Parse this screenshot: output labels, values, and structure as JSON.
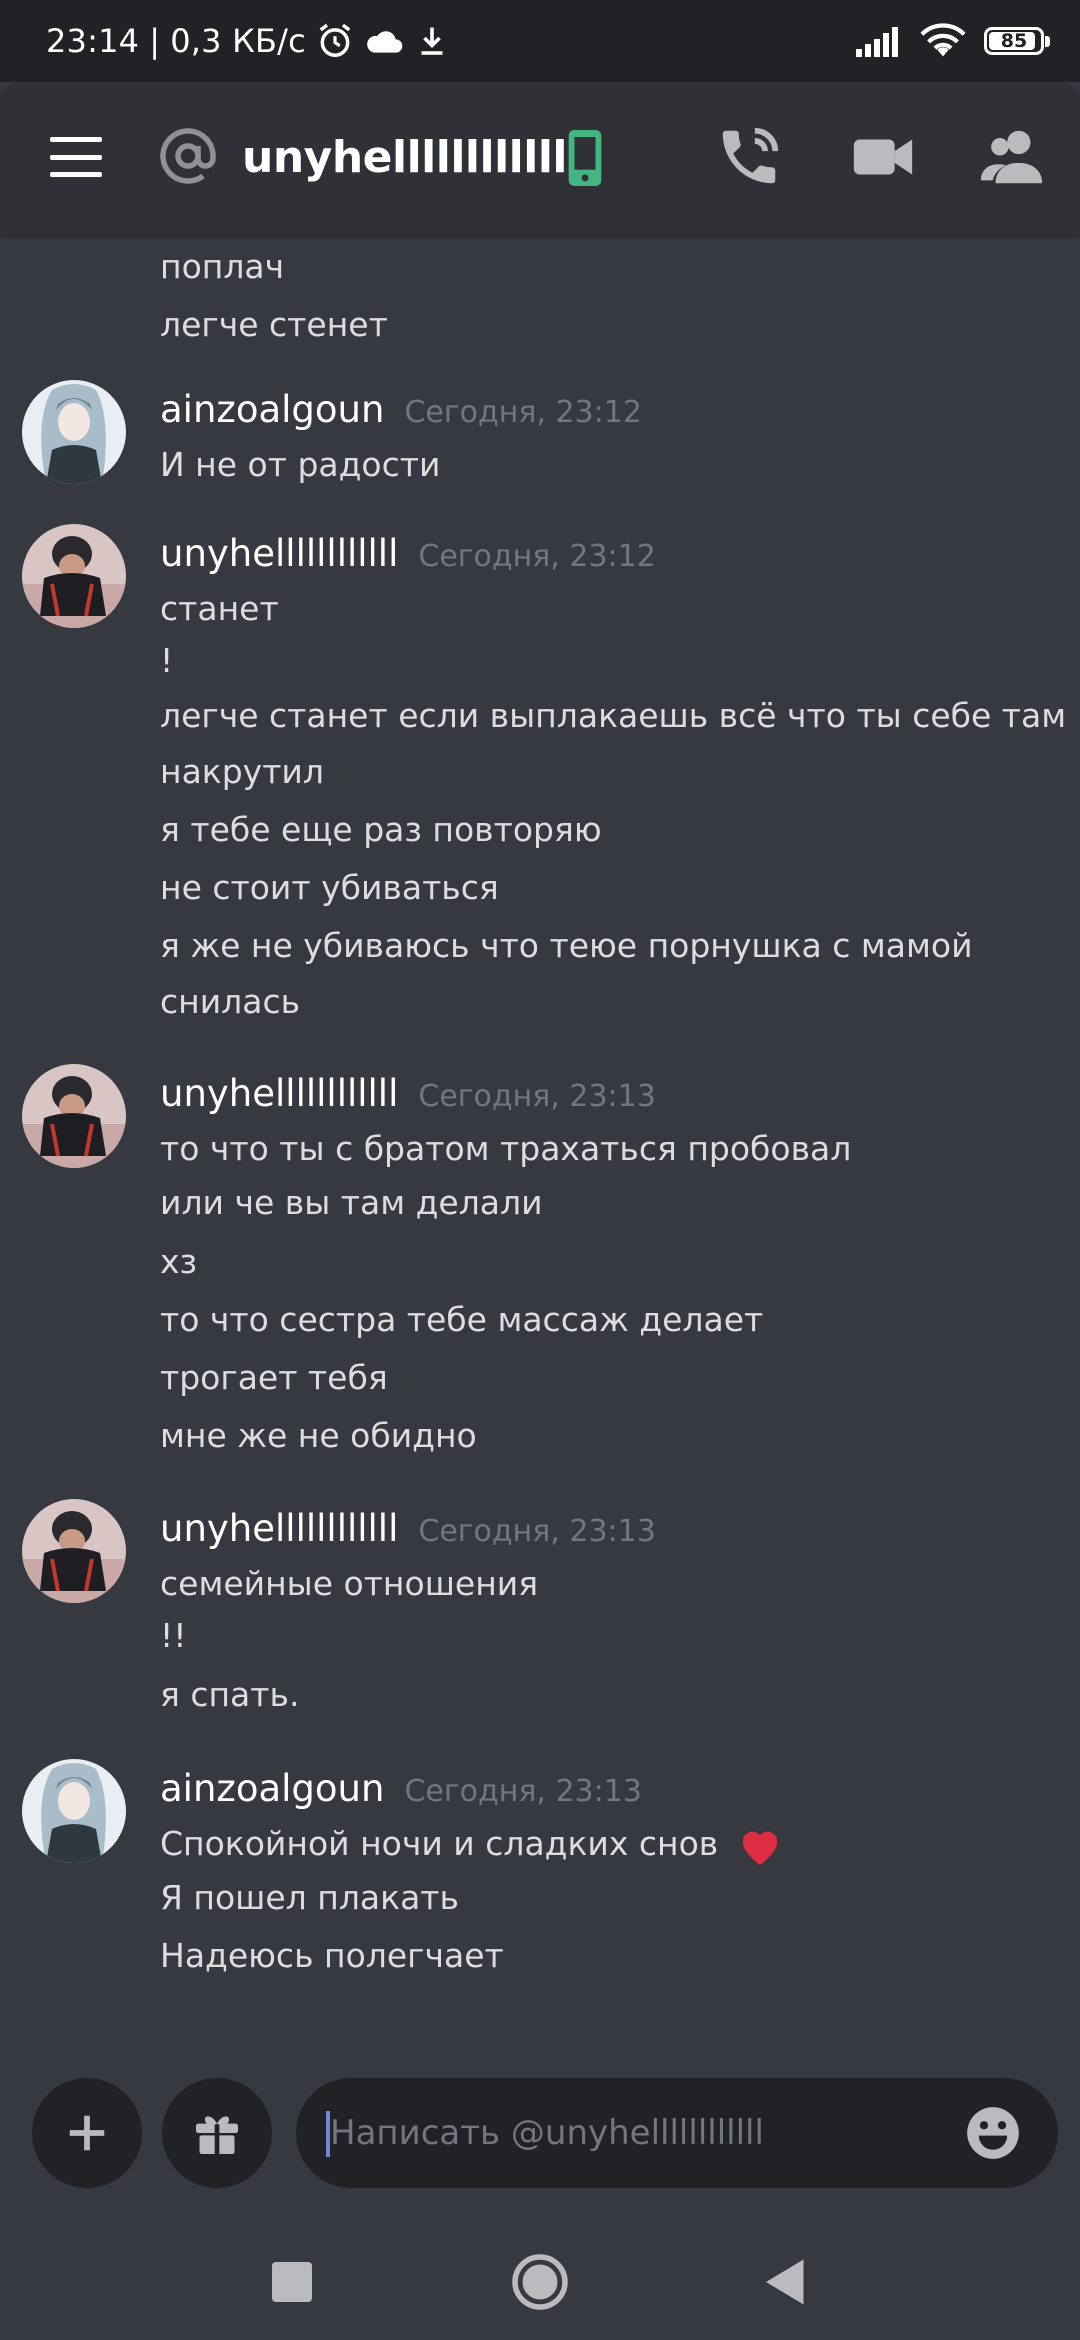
{
  "status_bar": {
    "time": "23:14",
    "separator": "|",
    "speed": "0,3 КБ/с",
    "battery": "85",
    "battery_level": 0.85
  },
  "header": {
    "channel_name": "unyhellllllllllll"
  },
  "messages": {
    "continued": [
      {
        "text": "поплач"
      },
      {
        "text": "легче стенет"
      }
    ],
    "g1": {
      "author": "ainzoalgoun",
      "time": "Сегодня, 23:12",
      "lines": [
        "И не от радости"
      ]
    },
    "g2": {
      "author": "unyhellllllllllll",
      "time": "Сегодня, 23:12",
      "lines": [
        "станет",
        "!",
        "легче станет если выплакаешь всё что ты себе там",
        "накрутил",
        "я тебе еще раз повторяю",
        "не стоит убиваться",
        "я же не убиваюсь что теюе порнушка с мамой",
        "снилась"
      ]
    },
    "g3": {
      "author": "unyhellllllllllll",
      "time": "Сегодня, 23:13",
      "lines": [
        "то что ты с братом трахаться пробовал",
        "или че вы там делали",
        "хз",
        "то что сестра тебе массаж делает",
        "трогает тебя",
        "мне же не обидно"
      ]
    },
    "g4": {
      "author": "unyhellllllllllll",
      "time": "Сегодня, 23:13",
      "lines": [
        "семейные отношения",
        "!!",
        "я спать."
      ]
    },
    "g5": {
      "author": "ainzoalgoun",
      "time": "Сегодня, 23:13",
      "lines": [
        "Спокойной ночи и сладких снов",
        "Я пошел плакать",
        "Надеюсь полегчает"
      ]
    }
  },
  "composer": {
    "placeholder": "Написать @unyhellllllllllll"
  },
  "colors": {
    "background": "#36393f",
    "header": "#2f3136",
    "input": "#202225",
    "online_green": "#43b581",
    "heart_red": "#dd2e44"
  },
  "icons": [
    "menu-icon",
    "at-icon",
    "mobile-icon",
    "voice-call-icon",
    "video-call-icon",
    "members-icon",
    "plus-icon",
    "gift-icon",
    "emoji-icon",
    "heart-icon",
    "nav-recents-icon",
    "nav-home-icon",
    "nav-back-icon"
  ]
}
